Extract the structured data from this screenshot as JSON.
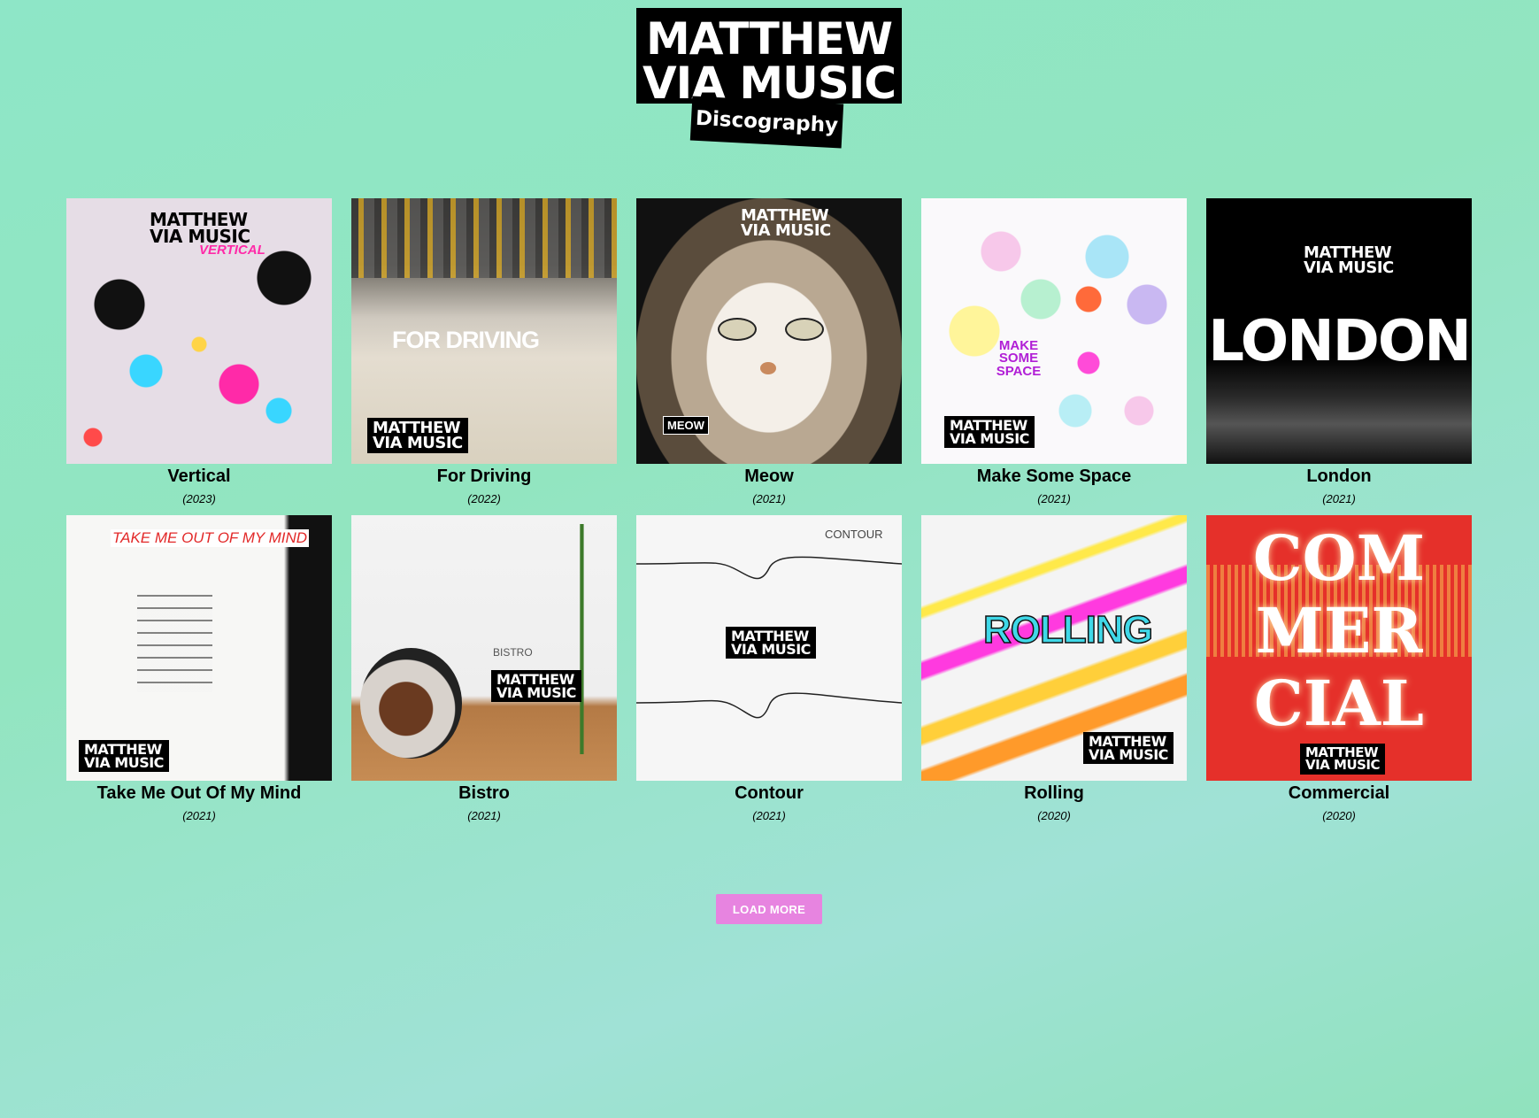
{
  "header": {
    "logo_line1": "MATTHEW",
    "logo_line2": "VIA MUSIC",
    "badge": "Discography"
  },
  "releases": [
    {
      "title": "Vertical",
      "year": "(2023)",
      "cover_text": "VERTICAL",
      "cover_icon": "abstract-collage-art"
    },
    {
      "title": "For Driving",
      "year": "(2022)",
      "cover_text": "FOR DRIVING",
      "cover_icon": "tunnel-road-photo"
    },
    {
      "title": "Meow",
      "year": "(2021)",
      "cover_text": "MEOW",
      "cover_icon": "cat-face-photo"
    },
    {
      "title": "Make Some Space",
      "year": "(2021)",
      "cover_text": "MAKE SOME SPACE",
      "cover_icon": "hexagon-pattern"
    },
    {
      "title": "London",
      "year": "(2021)",
      "cover_text": "LONDON",
      "cover_icon": "noise-texture"
    },
    {
      "title": "Take Me Out Of My Mind",
      "year": "(2021)",
      "cover_text": "TAKE ME OUT OF MY MIND",
      "cover_icon": "eyes-collage"
    },
    {
      "title": "Bistro",
      "year": "(2021)",
      "cover_text": "BISTRO",
      "cover_icon": "drum-kit-photo"
    },
    {
      "title": "Contour",
      "year": "(2021)",
      "cover_text": "CONTOUR",
      "cover_icon": "waveform-lines"
    },
    {
      "title": "Rolling",
      "year": "(2020)",
      "cover_text": "ROLLING",
      "cover_icon": "paint-streaks"
    },
    {
      "title": "Commercial",
      "year": "(2020)",
      "cover_text_lines": [
        "COM",
        "MER",
        "CIAL"
      ],
      "cover_icon": "neon-text"
    }
  ],
  "cover_brand": [
    "MATTHEW",
    "VIA MUSIC"
  ],
  "load_more": "LOAD MORE",
  "colors": {
    "accent": "#e784e0",
    "background": "#8ee6c7"
  }
}
